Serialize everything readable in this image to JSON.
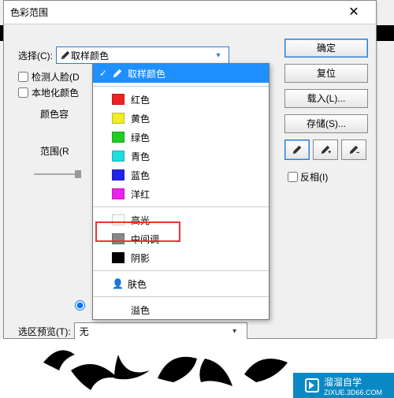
{
  "dialog": {
    "title": "色彩范围",
    "close_glyph": "✕",
    "select_label": "选择(C):",
    "select_value": "取样颜色",
    "detect_faces": "检测人脸(D",
    "localized": "本地化颜色",
    "tone": "颜色容",
    "range": "范围(R",
    "preview_label": "选区预览(T):",
    "preview_value": "无"
  },
  "buttons": {
    "ok": "确定",
    "cancel": "复位",
    "load": "载入(L)...",
    "save": "存储(S)...",
    "invert": "反相(I)"
  },
  "dropdown": {
    "sampled": "取样颜色",
    "colors": [
      {
        "label": "红色",
        "hex": "#e22"
      },
      {
        "label": "黄色",
        "hex": "#ee2"
      },
      {
        "label": "绿色",
        "hex": "#2c2"
      },
      {
        "label": "青色",
        "hex": "#2dd"
      },
      {
        "label": "蓝色",
        "hex": "#22e"
      },
      {
        "label": "洋红",
        "hex": "#e2e"
      }
    ],
    "tones": [
      {
        "label": "高光",
        "hex": "#fff"
      },
      {
        "label": "中间调",
        "hex": "#888"
      },
      {
        "label": "阴影",
        "hex": "#000"
      }
    ],
    "skin": "肤色",
    "oob": "溢色"
  },
  "logo": {
    "brand": "溜溜自学",
    "url": "ZIXUE.3D66.COM"
  }
}
